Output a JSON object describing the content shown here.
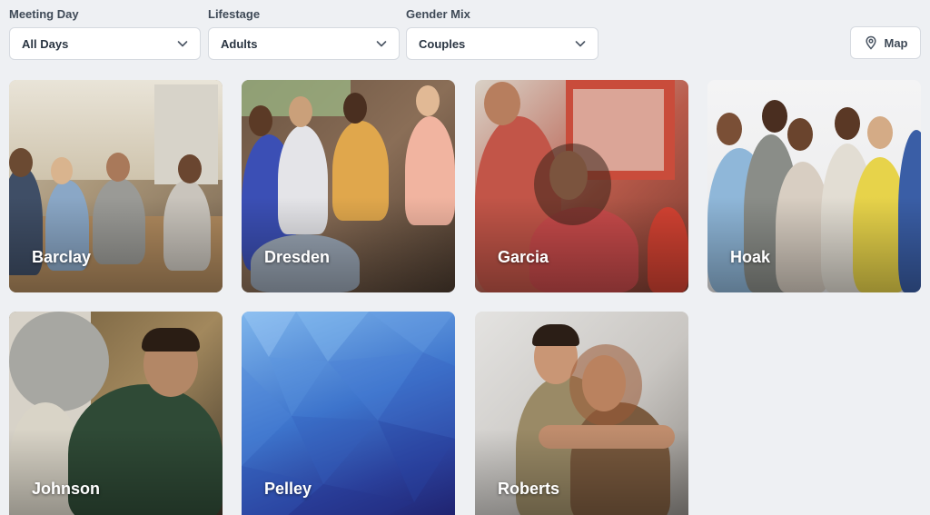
{
  "filters": {
    "meeting_day": {
      "label": "Meeting Day",
      "value": "All Days"
    },
    "lifestage": {
      "label": "Lifestage",
      "value": "Adults"
    },
    "gender_mix": {
      "label": "Gender Mix",
      "value": "Couples"
    }
  },
  "map_button": {
    "label": "Map",
    "icon": "map-pin-icon"
  },
  "groups": [
    {
      "name": "Barclay"
    },
    {
      "name": "Dresden"
    },
    {
      "name": "Garcia"
    },
    {
      "name": "Hoak"
    },
    {
      "name": "Johnson"
    },
    {
      "name": "Pelley"
    },
    {
      "name": "Roberts"
    }
  ]
}
